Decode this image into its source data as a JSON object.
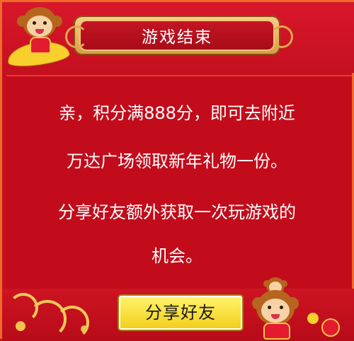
{
  "title": "游戏结束",
  "message": {
    "line1": "亲，积分满888分，即可去附近",
    "line2": "万达广场领取新年礼物一份。",
    "line3": "分享好友额外获取一次玩游戏的",
    "line4": "机会。"
  },
  "share_button": "分享好友",
  "colors": {
    "background": "#c80e1c",
    "button_yellow": "#f8e63a",
    "plaque_gold": "#e7b25e",
    "text_white": "#ffffff"
  }
}
